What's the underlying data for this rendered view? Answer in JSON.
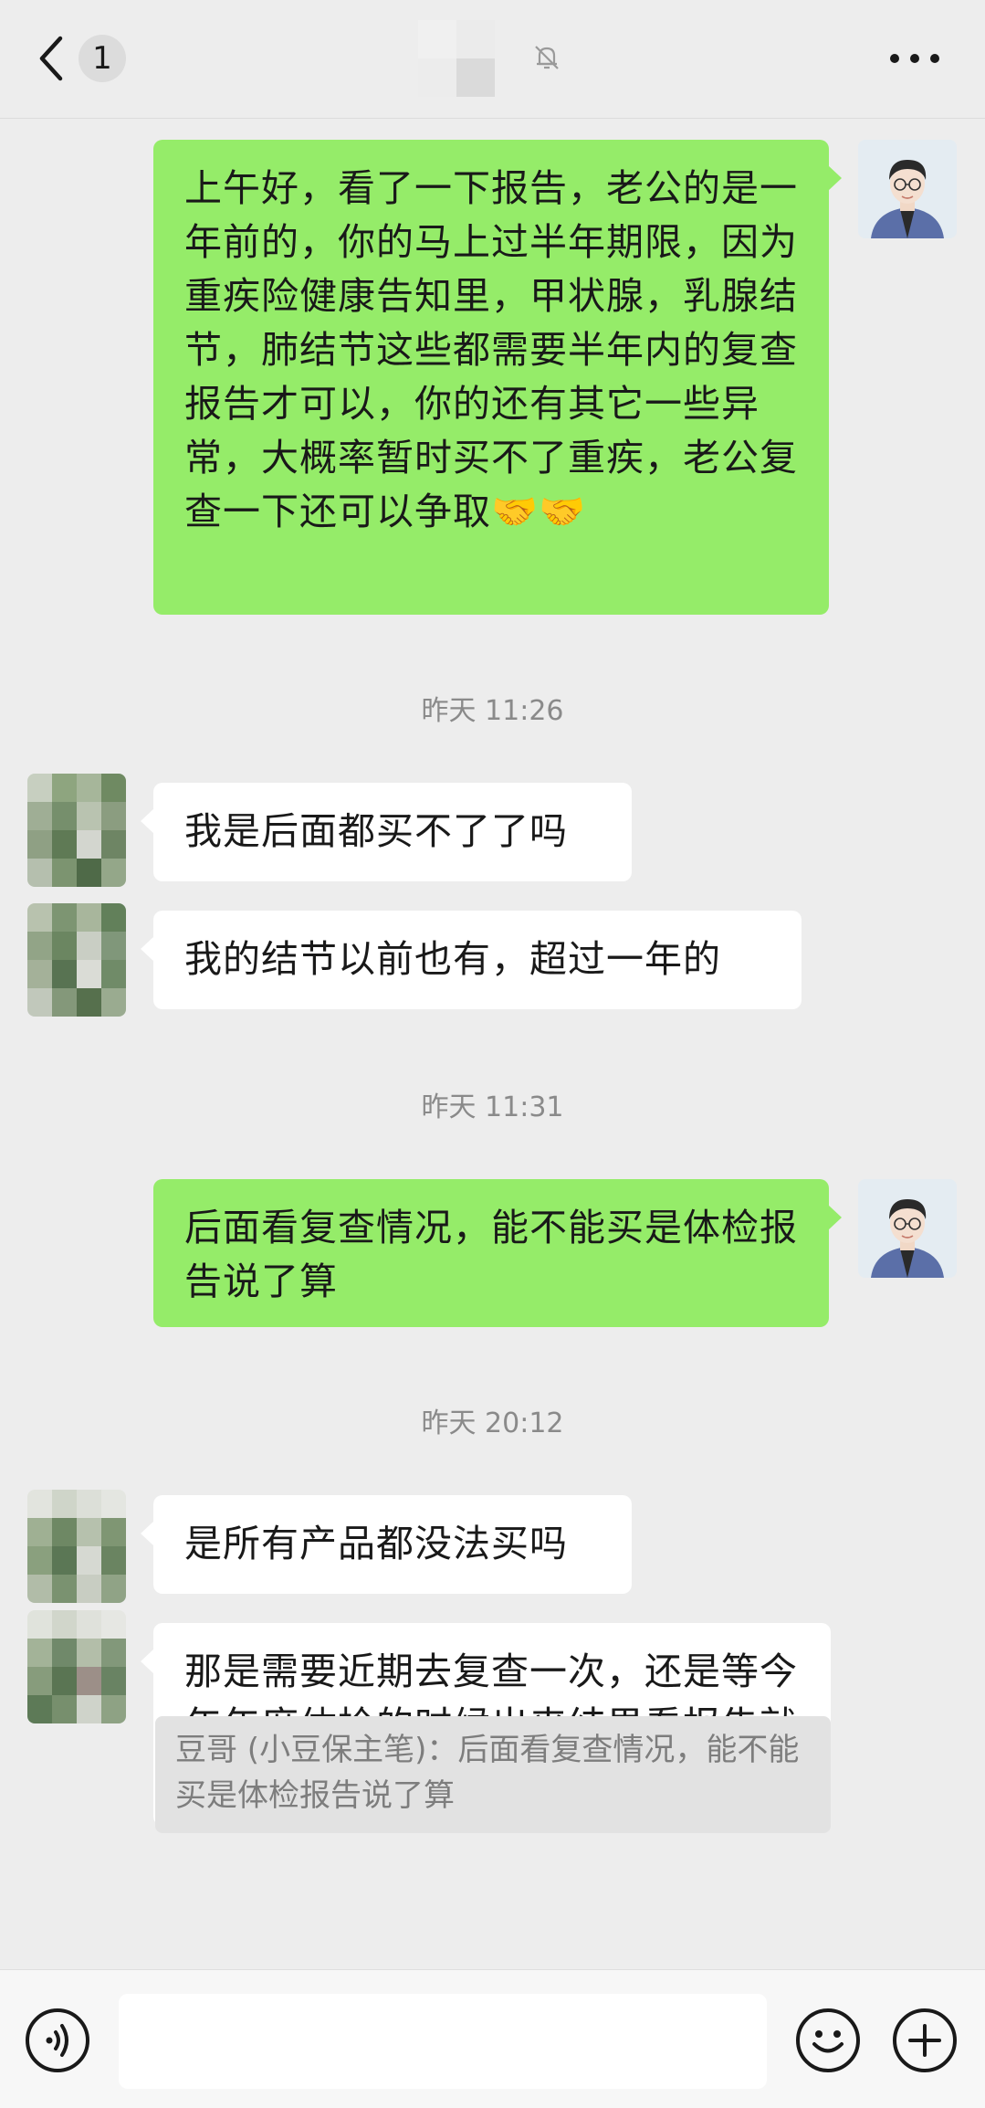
{
  "header": {
    "unread_count": "1"
  },
  "messages": [
    {
      "side": "self",
      "text": "上午好，看了一下报告，老公的是一年前的，你的马上过半年期限，因为重疾险健康告知里，甲状腺，乳腺结节，肺结节这些都需要半年内的复查报告才可以，你的还有其它一些异常，大概率暂时买不了重疾，老公复查一下还可以争取🤝🤝"
    },
    {
      "timestamp": "昨天 11:26"
    },
    {
      "side": "other",
      "text": "我是后面都买不了了吗"
    },
    {
      "side": "other",
      "text": "我的结节以前也有，超过一年的"
    },
    {
      "timestamp": "昨天 11:31"
    },
    {
      "side": "self",
      "text": "后面看复查情况，能不能买是体检报告说了算"
    },
    {
      "timestamp": "昨天 20:12"
    },
    {
      "side": "other",
      "text": "是所有产品都没法买吗"
    },
    {
      "side": "other",
      "text": "那是需要近期去复查一次，还是等今年年度体检的时候出来结果看报告就行呢",
      "quote": "豆哥 (小豆保主笔)：后面看复查情况，能不能买是体检报告说了算"
    }
  ],
  "icons": {
    "back": "chevron-left-icon",
    "mute": "bell-off-icon",
    "more": "more-dots-icon",
    "voice": "voice-icon",
    "emoji": "emoji-icon",
    "plus": "plus-icon"
  },
  "colors": {
    "self_bubble": "#95ec69",
    "other_bubble": "#ffffff",
    "background": "#ededed"
  }
}
